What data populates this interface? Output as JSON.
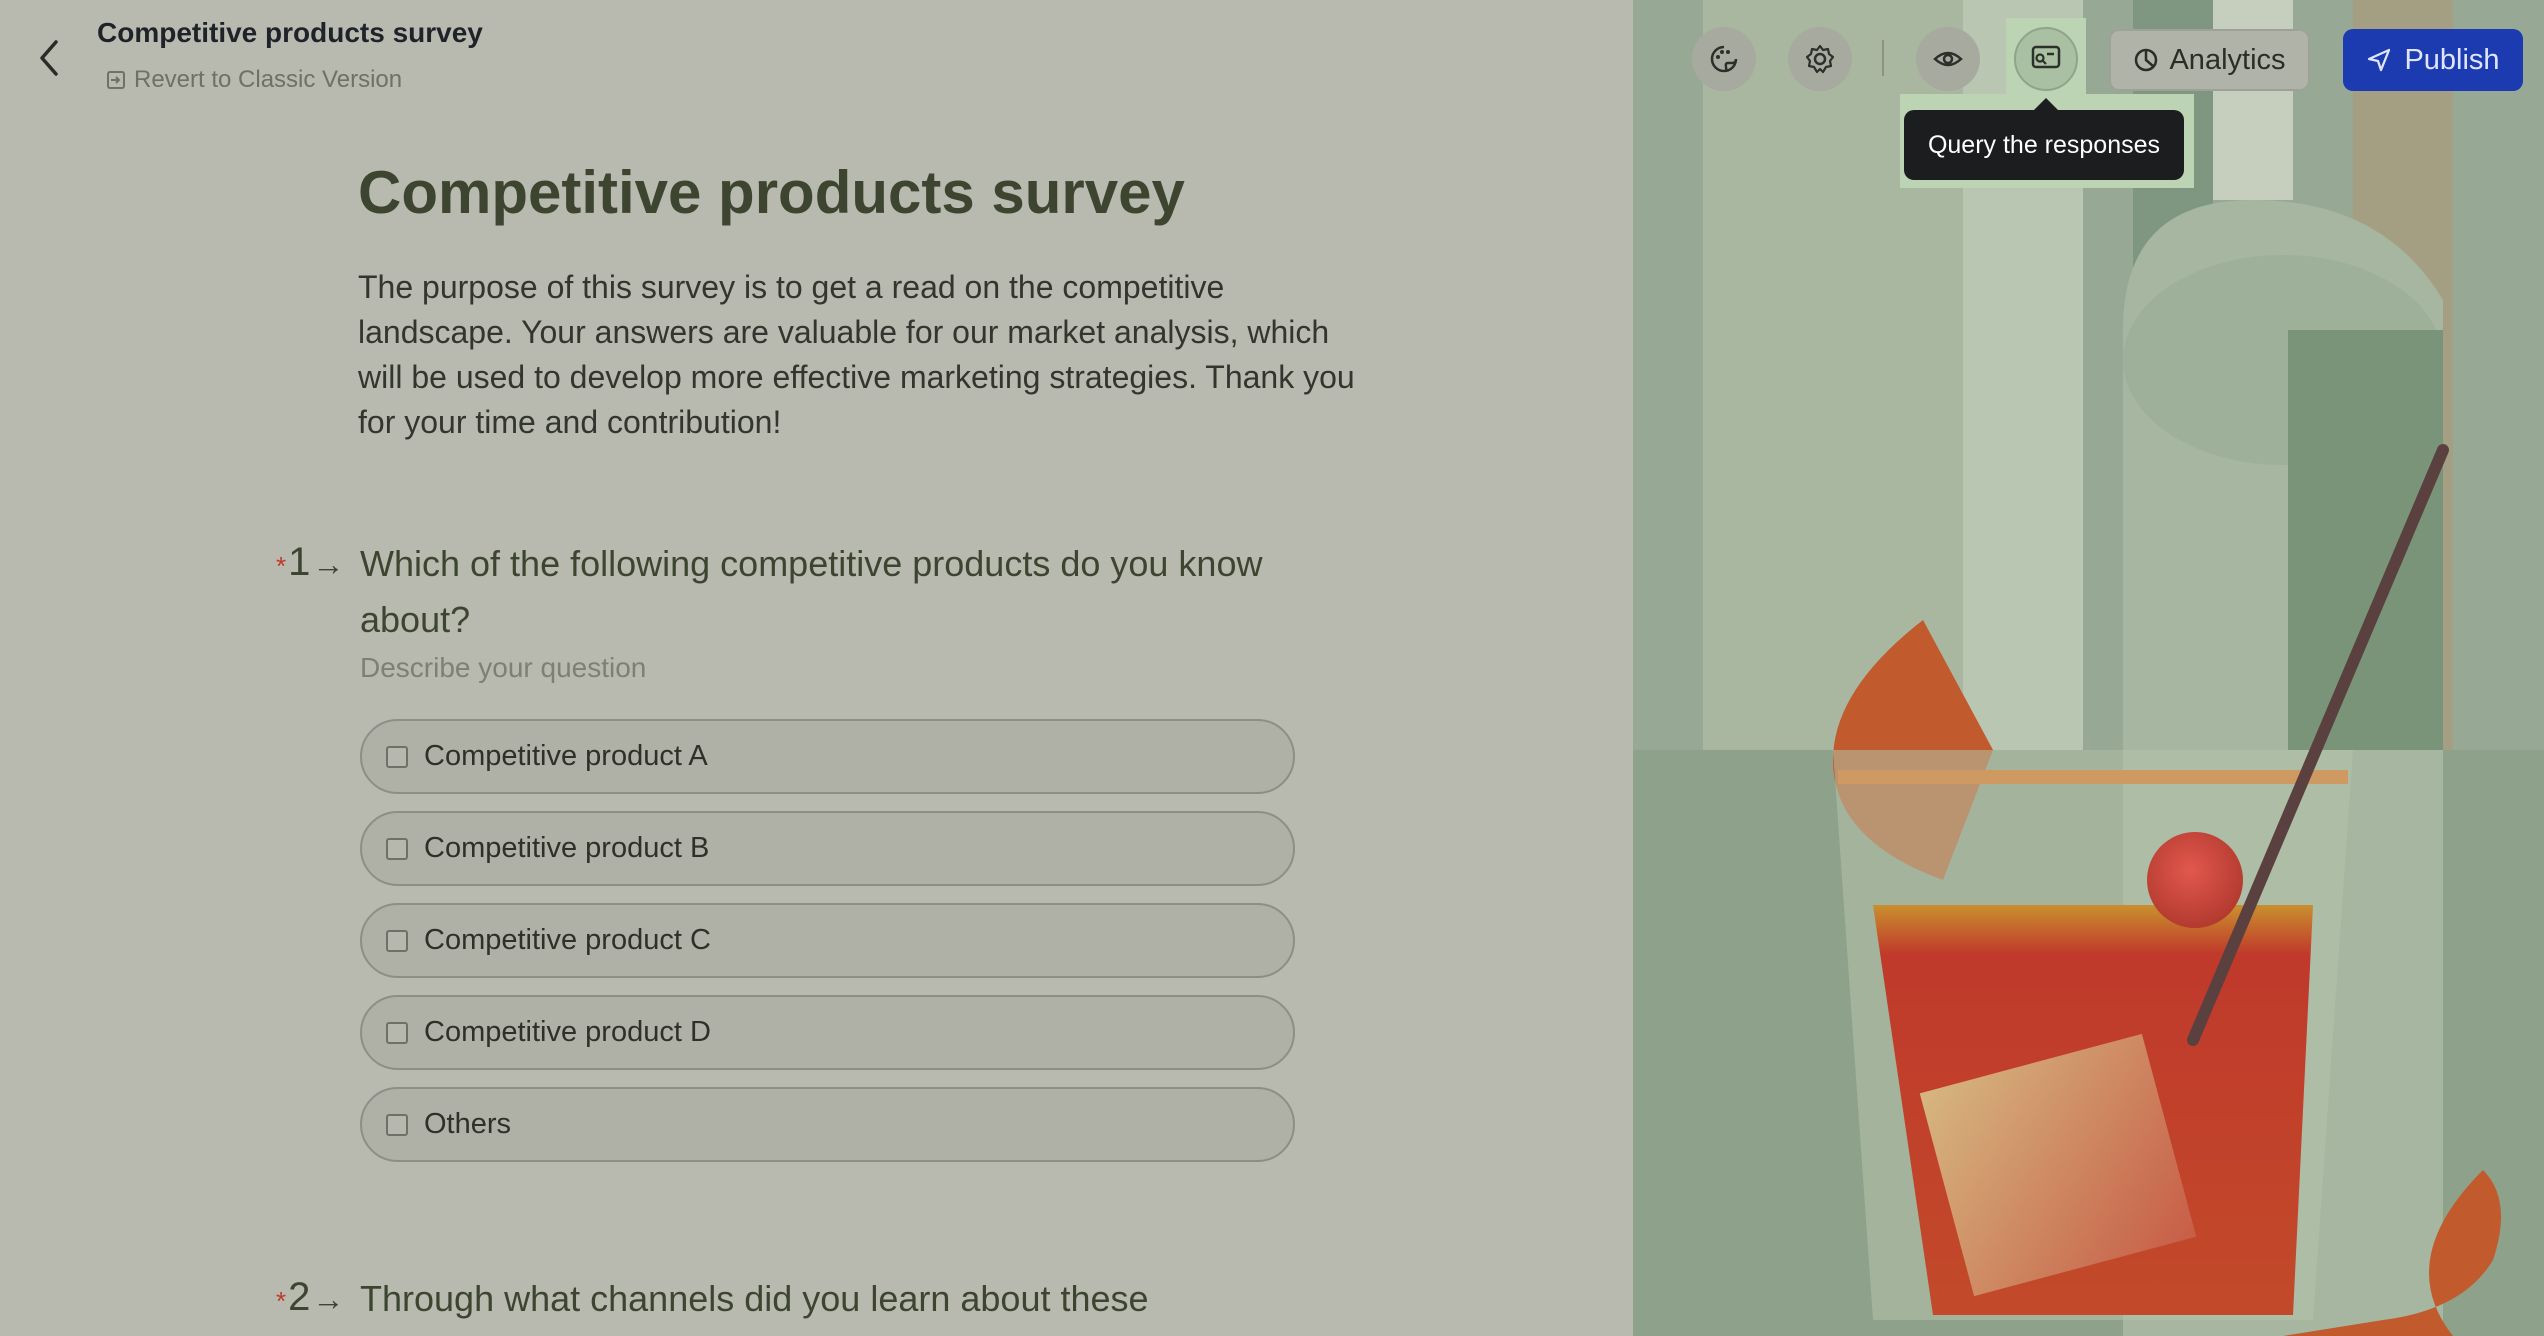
{
  "header": {
    "doc_title": "Competitive products survey",
    "revert_label": "Revert to Classic Version"
  },
  "toolbar": {
    "analytics_label": "Analytics",
    "publish_label": "Publish",
    "tooltip": "Query the responses",
    "icons": [
      "theme-icon",
      "settings-icon",
      "preview-icon",
      "query-responses-icon"
    ]
  },
  "survey": {
    "title": "Competitive products survey",
    "description": "The purpose of this survey is to get a read on the competitive landscape. Your answers are valuable for our market analysis, which will be used to develop more effective marketing strategies. Thank you for your time and contribution!"
  },
  "questions": [
    {
      "number": "1",
      "required_mark": "*",
      "title": "Which of the following competitive products do you know about?",
      "description_placeholder": "Describe your question",
      "options": [
        "Competitive product A",
        "Competitive product B",
        "Competitive product C",
        "Competitive product D",
        "Others"
      ]
    },
    {
      "number": "2",
      "required_mark": "*",
      "title": "Through what channels did you learn about these"
    }
  ],
  "colors": {
    "publish": "#1c3bb0",
    "required": "#c0392b",
    "title": "#3d4530"
  }
}
